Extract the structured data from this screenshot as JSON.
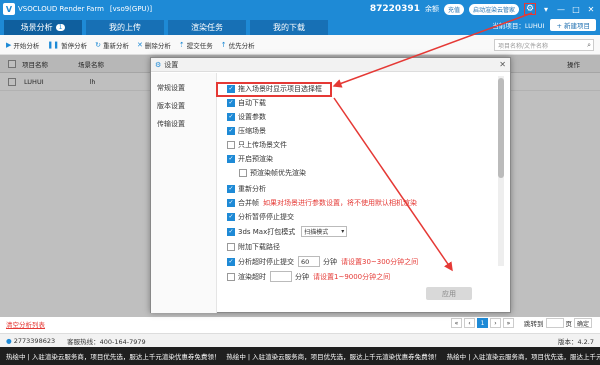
{
  "titlebar": {
    "app_name": "VSOCLOUD Render Farm",
    "project": "[vso9(GPU)]",
    "balance": "87220391",
    "user": "余额",
    "top_up": "充值",
    "butler": "启动渲染云管家",
    "minimize": "—",
    "maximize": "□",
    "close": "✕"
  },
  "tabs": [
    {
      "label": "场景分析",
      "badge": "1"
    },
    {
      "label": "我的上传"
    },
    {
      "label": "渲染任务"
    },
    {
      "label": "我的下载"
    }
  ],
  "current_project": "当前项目：LUHUI",
  "new_project": "+ 新建项目",
  "toolbar": {
    "start": "开始分析",
    "pause": "暂停分析",
    "reanalyze": "重新分析",
    "delete": "删除分析",
    "submit": "提交任务",
    "priority": "优先分析",
    "search_placeholder": "项目名称/文件名称"
  },
  "table": {
    "col_name": "项目名称",
    "col_scene": "场景名称",
    "col_ops": "操作",
    "row_name": "LUHUI",
    "row_scene": "lh"
  },
  "dialog": {
    "title": "设置",
    "side": [
      "常规设置",
      "版本设置",
      "传输设置"
    ],
    "options": {
      "show_project_selector": "拖入场景时显示项目选择框",
      "auto_download": "自动下载",
      "settings_params": "设置参数",
      "compress_scene": "压缩场景",
      "upload_only_scene": "只上传场景文件",
      "enable_prerender": "开启预渲染",
      "prerender_priority": "预渲染帧优先渲染",
      "reanalyze": "重新分析",
      "merge_frames": "合并帧",
      "merge_hint": "如果对场景进行参数设置，将不使用默认相机渲染",
      "pause_analysis_submit": "分析暂停停止提交",
      "max_mode": "3ds Max打包模式",
      "max_mode_value": "扫描模式",
      "attach_download": "附加下载路径",
      "analysis_timeout": "分析超时停止提交",
      "analysis_timeout_value": "60",
      "unit_minutes": "分钟",
      "timeout_hint": "请设置30~300分钟之间",
      "render_timeout": "渲染超时",
      "render_unit": "分钟",
      "render_hint": "请设置1~9000分钟之间"
    },
    "apply": "应用"
  },
  "bottom": {
    "clear_link": "清空分析列表",
    "page": "1",
    "jump_to": "跳转到",
    "page_unit": "页",
    "confirm": "确定"
  },
  "status": {
    "qq": "2773398623",
    "hotline": "客服热线：400-164-7979",
    "version": "版本：4.2.7"
  },
  "ticker": {
    "text": "热绘中 | 入驻渲染云服务商，项目优先选，服达上千元渲染优惠券免费领！"
  }
}
